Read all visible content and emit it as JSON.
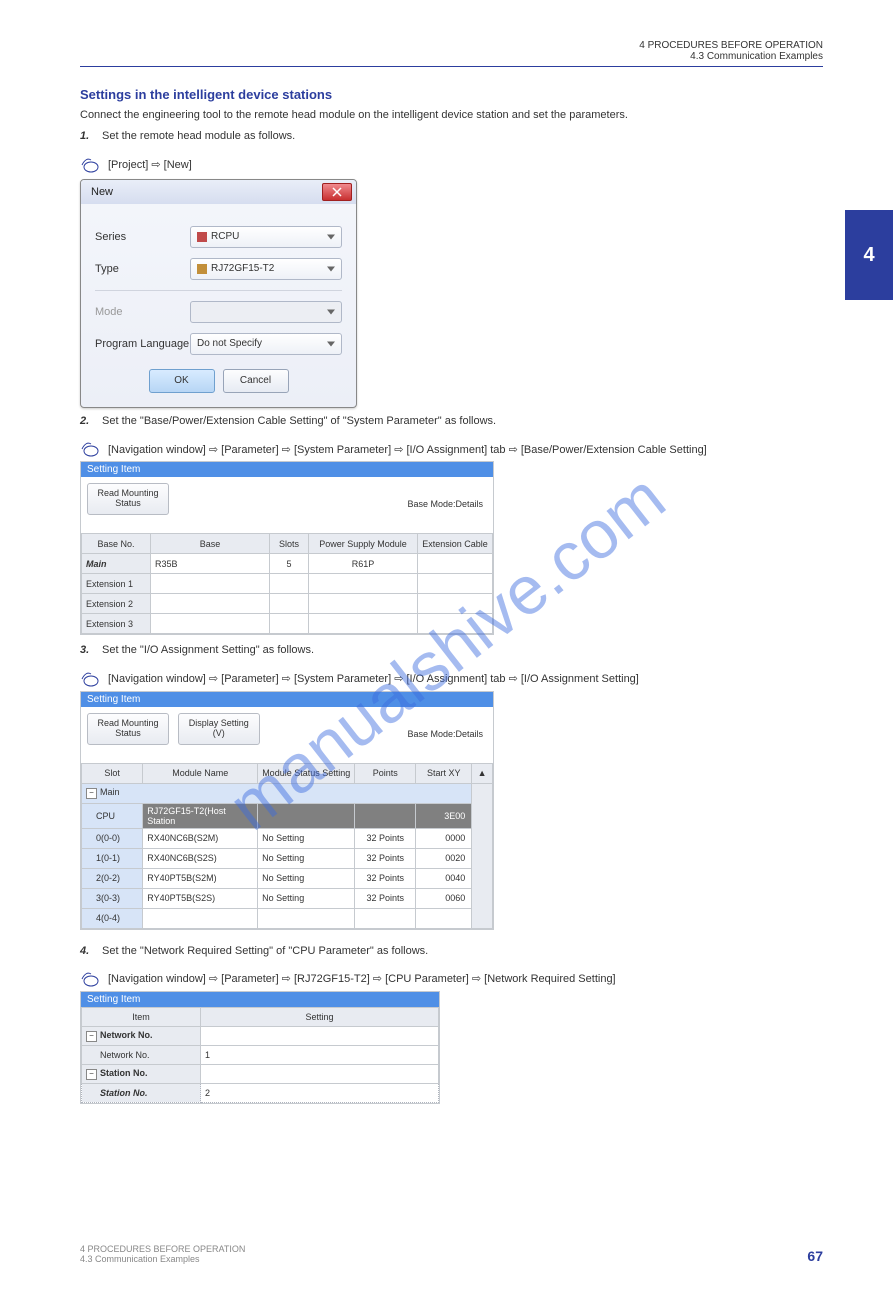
{
  "tab_number": "4",
  "header": "4 PROCEDURES BEFORE OPERATION\n4.3 Communication Examples",
  "watermark": "manualshive.com",
  "s1": {
    "title": "Settings in the intelligent device stations",
    "intro": "Connect the engineering tool to the remote head module on the intelligent device station and set the parameters.",
    "step1_num": "1.",
    "step1_text": "Set the remote head module as follows.",
    "nav1": "[Project] ⇨ [New]",
    "step2_num": "2.",
    "step2_text": "Set the \"Base/Power/Extension Cable Setting\" of \"System Parameter\" as follows.",
    "nav2": "[Navigation window] ⇨ [Parameter] ⇨ [System Parameter] ⇨ [I/O Assignment] tab ⇨ [Base/Power/Extension Cable Setting]",
    "step3_num": "3.",
    "step3_text": "Set the \"I/O Assignment Setting\" as follows.",
    "nav3": "[Navigation window] ⇨ [Parameter] ⇨ [System Parameter] ⇨ [I/O Assignment] tab ⇨ [I/O Assignment Setting]",
    "step4_num": "4.",
    "step4_text": "Set the \"Network Required Setting\" of \"CPU Parameter\" as follows.",
    "nav4": "[Navigation window] ⇨ [Parameter] ⇨ [RJ72GF15-T2] ⇨ [CPU Parameter] ⇨ [Network Required Setting]"
  },
  "dialog": {
    "title": "New",
    "series_label": "Series",
    "series_value": "RCPU",
    "type_label": "Type",
    "type_value": "RJ72GF15-T2",
    "mode_label": "Mode",
    "mode_value": "",
    "lang_label": "Program Language",
    "lang_value": "Do not Specify",
    "ok": "OK",
    "cancel": "Cancel"
  },
  "panel1": {
    "title": "Setting Item",
    "btn": "Read Mounting\nStatus",
    "mode": "Base Mode:Details",
    "cols": [
      "Base No.",
      "Base",
      "Slots",
      "Power Supply Module",
      "Extension Cable"
    ],
    "rows": [
      {
        "no": "Main",
        "base": "R35B",
        "slots": "5",
        "psu": "R61P",
        "cable": ""
      },
      {
        "no": "Extension 1"
      },
      {
        "no": "Extension 2"
      },
      {
        "no": "Extension 3"
      }
    ]
  },
  "panel2": {
    "title": "Setting Item",
    "btn1": "Read Mounting\nStatus",
    "btn2": "Display Setting\n(V)",
    "mode": "Base Mode:Details",
    "cols": [
      "Slot",
      "Module Name",
      "Module Status Setting",
      "Points",
      "Start XY",
      ""
    ],
    "rows": [
      {
        "slot": "Main",
        "tree": true
      },
      {
        "slot": "CPU",
        "name": "RJ72GF15-T2(Host Station",
        "status": "",
        "points": "",
        "xy": "3E00",
        "sel": true
      },
      {
        "slot": "0(0-0)",
        "name": "RX40NC6B(S2M)",
        "status": "No Setting",
        "points": "32 Points",
        "xy": "0000"
      },
      {
        "slot": "1(0-1)",
        "name": "RX40NC6B(S2S)",
        "status": "No Setting",
        "points": "32 Points",
        "xy": "0020"
      },
      {
        "slot": "2(0-2)",
        "name": "RY40PT5B(S2M)",
        "status": "No Setting",
        "points": "32 Points",
        "xy": "0040"
      },
      {
        "slot": "3(0-3)",
        "name": "RY40PT5B(S2S)",
        "status": "No Setting",
        "points": "32 Points",
        "xy": "0060"
      },
      {
        "slot": "4(0-4)"
      }
    ]
  },
  "panel3": {
    "title": "Setting Item",
    "cols": [
      "Item",
      "Setting"
    ],
    "rows": [
      {
        "indent": 0,
        "item": "Network No.",
        "tree": true
      },
      {
        "indent": 1,
        "item": "Network No.",
        "val": "1"
      },
      {
        "indent": 0,
        "item": "Station No.",
        "tree": true
      },
      {
        "indent": 1,
        "item": "Station No.",
        "val": "2",
        "bold": true,
        "dotted": true
      }
    ]
  },
  "footer": {
    "chapter": "4 PROCEDURES BEFORE OPERATION",
    "section": "4.3 Communication Examples",
    "page": "67"
  }
}
